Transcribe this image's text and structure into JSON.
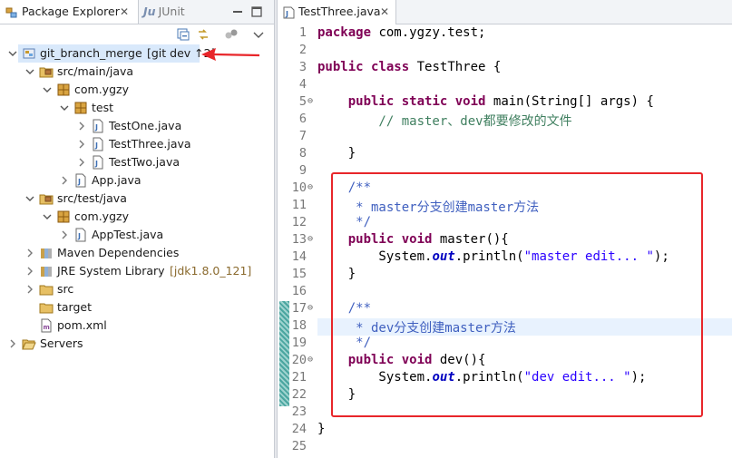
{
  "left_panel": {
    "tabs": [
      {
        "label": "Package Explorer",
        "icon": "package-explorer-icon",
        "close": "✕"
      },
      {
        "label": "JUnit",
        "icon": "junit-icon"
      }
    ],
    "toolbar_icons": [
      "collapse-all-icon",
      "link-with-editor-icon",
      "focus-icon",
      "view-menu-icon",
      "minimize-icon",
      "maximize-icon"
    ],
    "tree": [
      {
        "label": "git_branch_merge",
        "decoration": "[git dev ↑2]",
        "icon": "git-project-icon",
        "expanded": true,
        "level": 0,
        "selected": true
      },
      {
        "label": "src/main/java",
        "icon": "source-folder-icon",
        "expanded": true,
        "level": 1
      },
      {
        "label": "com.ygzy",
        "icon": "package-icon",
        "expanded": true,
        "level": 2
      },
      {
        "label": "test",
        "icon": "package-icon",
        "expanded": true,
        "level": 3
      },
      {
        "label": "TestOne.java",
        "icon": "java-file-icon",
        "expanded": false,
        "level": 4
      },
      {
        "label": "TestThree.java",
        "icon": "java-file-icon",
        "expanded": false,
        "level": 4
      },
      {
        "label": "TestTwo.java",
        "icon": "java-file-icon",
        "expanded": false,
        "level": 4
      },
      {
        "label": "App.java",
        "icon": "java-file-icon",
        "expanded": false,
        "level": 3
      },
      {
        "label": "src/test/java",
        "icon": "source-folder-icon",
        "expanded": true,
        "level": 1
      },
      {
        "label": "com.ygzy",
        "icon": "package-icon",
        "expanded": true,
        "level": 2
      },
      {
        "label": "AppTest.java",
        "icon": "java-file-icon",
        "expanded": false,
        "level": 3
      },
      {
        "label": "Maven Dependencies",
        "icon": "library-icon",
        "expanded": false,
        "level": 1
      },
      {
        "label": "JRE System Library",
        "decoration": "[jdk1.8.0_121]",
        "icon": "library-icon",
        "expanded": false,
        "level": 1
      },
      {
        "label": "src",
        "icon": "folder-icon",
        "expanded": false,
        "level": 1
      },
      {
        "label": "target",
        "icon": "folder-icon",
        "expanded": null,
        "level": 1
      },
      {
        "label": "pom.xml",
        "icon": "xml-file-icon",
        "expanded": null,
        "level": 1
      },
      {
        "label": "Servers",
        "icon": "folder-open-icon",
        "expanded": false,
        "level": 0
      }
    ]
  },
  "editor": {
    "tab": {
      "label": "TestThree.java",
      "close": "✕",
      "icon": "java-file-icon"
    },
    "current_line": 18,
    "changed_lines": [
      17,
      22
    ],
    "lines": [
      {
        "n": "1",
        "tokens": [
          {
            "t": "package",
            "c": "kw"
          },
          {
            "t": " com.ygzy.test;",
            "c": ""
          }
        ]
      },
      {
        "n": "2",
        "tokens": []
      },
      {
        "n": "3",
        "tokens": [
          {
            "t": "public",
            "c": "kw"
          },
          {
            "t": " ",
            "c": ""
          },
          {
            "t": "class",
            "c": "kw"
          },
          {
            "t": " TestThree {",
            "c": ""
          }
        ]
      },
      {
        "n": "4",
        "tokens": []
      },
      {
        "n": "5",
        "fold": "⊖",
        "tokens": [
          {
            "t": "    ",
            "c": ""
          },
          {
            "t": "public",
            "c": "kw"
          },
          {
            "t": " ",
            "c": ""
          },
          {
            "t": "static",
            "c": "kw"
          },
          {
            "t": " ",
            "c": ""
          },
          {
            "t": "void",
            "c": "kw"
          },
          {
            "t": " main(String[] args) {",
            "c": ""
          }
        ]
      },
      {
        "n": "6",
        "tokens": [
          {
            "t": "        // master、dev都要修改的文件",
            "c": "lc"
          }
        ]
      },
      {
        "n": "7",
        "tokens": []
      },
      {
        "n": "8",
        "tokens": [
          {
            "t": "    }",
            "c": ""
          }
        ]
      },
      {
        "n": "9",
        "tokens": []
      },
      {
        "n": "10",
        "fold": "⊖",
        "tokens": [
          {
            "t": "    /**",
            "c": "cm"
          }
        ]
      },
      {
        "n": "11",
        "tokens": [
          {
            "t": "     * master分支创建master方法",
            "c": "cm"
          }
        ]
      },
      {
        "n": "12",
        "tokens": [
          {
            "t": "     */",
            "c": "cm"
          }
        ]
      },
      {
        "n": "13",
        "fold": "⊖",
        "tokens": [
          {
            "t": "    ",
            "c": ""
          },
          {
            "t": "public",
            "c": "kw"
          },
          {
            "t": " ",
            "c": ""
          },
          {
            "t": "void",
            "c": "kw"
          },
          {
            "t": " master(){",
            "c": ""
          }
        ]
      },
      {
        "n": "14",
        "tokens": [
          {
            "t": "        System.",
            "c": ""
          },
          {
            "t": "out",
            "c": "fld"
          },
          {
            "t": ".println(",
            "c": ""
          },
          {
            "t": "\"master edit... \"",
            "c": "st"
          },
          {
            "t": ");",
            "c": ""
          }
        ]
      },
      {
        "n": "15",
        "tokens": [
          {
            "t": "    }",
            "c": ""
          }
        ]
      },
      {
        "n": "16",
        "tokens": []
      },
      {
        "n": "17",
        "fold": "⊖",
        "tokens": [
          {
            "t": "    /**",
            "c": "cm"
          }
        ]
      },
      {
        "n": "18",
        "tokens": [
          {
            "t": "     * dev分支创建master方法",
            "c": "cm"
          }
        ]
      },
      {
        "n": "19",
        "tokens": [
          {
            "t": "     */",
            "c": "cm"
          }
        ]
      },
      {
        "n": "20",
        "fold": "⊖",
        "tokens": [
          {
            "t": "    ",
            "c": ""
          },
          {
            "t": "public",
            "c": "kw"
          },
          {
            "t": " ",
            "c": ""
          },
          {
            "t": "void",
            "c": "kw"
          },
          {
            "t": " dev(){",
            "c": ""
          }
        ]
      },
      {
        "n": "21",
        "tokens": [
          {
            "t": "        System.",
            "c": ""
          },
          {
            "t": "out",
            "c": "fld"
          },
          {
            "t": ".println(",
            "c": ""
          },
          {
            "t": "\"dev edit... \"",
            "c": "st"
          },
          {
            "t": ");",
            "c": ""
          }
        ]
      },
      {
        "n": "22",
        "tokens": [
          {
            "t": "    }",
            "c": ""
          }
        ]
      },
      {
        "n": "23",
        "tokens": []
      },
      {
        "n": "24",
        "tokens": [
          {
            "t": "}",
            "c": ""
          }
        ]
      },
      {
        "n": "25",
        "tokens": []
      }
    ]
  },
  "annotations": {
    "highlight_color": "#e8262a"
  }
}
